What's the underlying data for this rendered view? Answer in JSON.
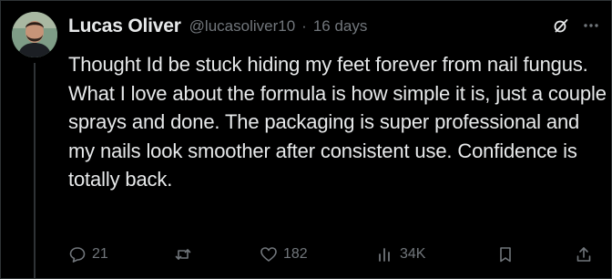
{
  "post": {
    "author": {
      "display_name": "Lucas Oliver",
      "handle": "@lucasoliver10",
      "avatar": "avatar-photo"
    },
    "separator": "·",
    "time": "16 days",
    "text": "Thought Id be stuck hiding my feet forever from nail fungus. What I love about the formula is how simple it is, just a couple sprays and done. The packaging is super professional and my nails look smoother after consistent use. Confidence is totally back."
  },
  "header_icons": [
    "grok-icon",
    "more-icon"
  ],
  "actions": {
    "reply": {
      "icon": "reply-icon",
      "count": "21"
    },
    "repost": {
      "icon": "repost-icon",
      "count": ""
    },
    "like": {
      "icon": "heart-icon",
      "count": "182"
    },
    "views": {
      "icon": "views-icon",
      "count": "34K"
    },
    "bookmark": {
      "icon": "bookmark-icon"
    },
    "share": {
      "icon": "share-icon"
    }
  },
  "colors": {
    "background": "#000000",
    "text_primary": "#e7e9ea",
    "text_secondary": "#71767b",
    "border": "#2f3336"
  }
}
